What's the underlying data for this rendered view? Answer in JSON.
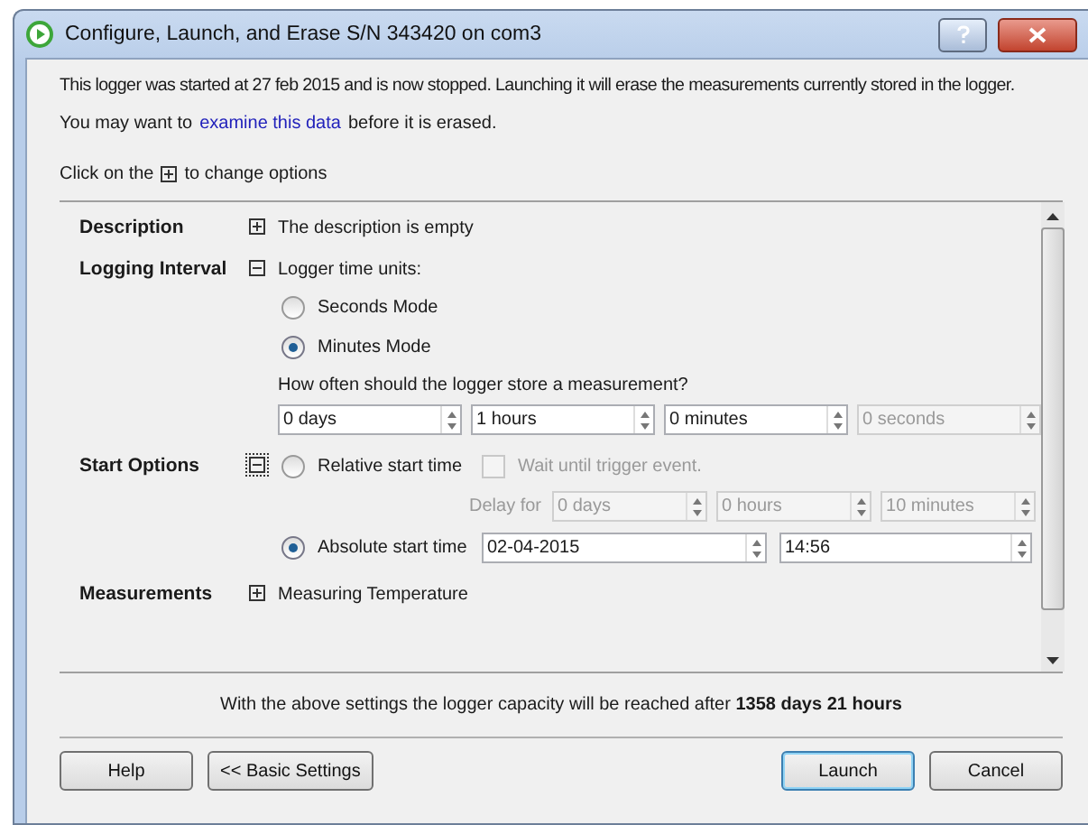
{
  "window": {
    "title": "Configure, Launch, and Erase S/N 343420 on com3"
  },
  "message": "This logger was started at 27 feb 2015 and is now stopped. Launching it will erase the measurements currently stored in the logger.",
  "hint": {
    "before": "You may want to",
    "link": "examine this data",
    "after": "before it is erased."
  },
  "instruction": {
    "before": "Click on the",
    "after": "to change options"
  },
  "sections": [
    {
      "kind": "summary",
      "label": "Description",
      "expanded": false,
      "focused": false,
      "summary": "The description is empty"
    },
    {
      "kind": "interval",
      "label": "Logging Interval",
      "expanded": true,
      "focused": false,
      "units_label": "Logger time units:",
      "modes": [
        {
          "label": "Seconds Mode",
          "selected": false
        },
        {
          "label": "Minutes Mode",
          "selected": true
        }
      ],
      "question": "How often should the logger store a measurement?",
      "fields": [
        {
          "value": "0 days",
          "disabled": false
        },
        {
          "value": "1 hours",
          "disabled": false
        },
        {
          "value": "0 minutes",
          "disabled": false
        },
        {
          "value": "0 seconds",
          "disabled": true
        }
      ]
    },
    {
      "kind": "start",
      "label": "Start Options",
      "expanded": true,
      "focused": true,
      "relative": {
        "label": "Relative start time",
        "selected": false
      },
      "trigger": {
        "label": "Wait until trigger event.",
        "checked": false,
        "disabled": true
      },
      "delay_label": "Delay for",
      "delay_fields": [
        {
          "value": "0 days",
          "disabled": true
        },
        {
          "value": "0 hours",
          "disabled": true
        },
        {
          "value": "10 minutes",
          "disabled": true
        }
      ],
      "absolute": {
        "label": "Absolute start time",
        "selected": true
      },
      "date": "02-04-2015",
      "time": "14:56"
    },
    {
      "kind": "summary",
      "label": "Measurements",
      "expanded": false,
      "focused": false,
      "summary": "Measuring Temperature"
    }
  ],
  "capacity": "With the above settings the logger capacity will be reached after **1358 days 21 hours**",
  "buttons_left": [
    {
      "label": "Help",
      "default": false
    },
    {
      "label": "<< Basic Settings",
      "default": false
    }
  ],
  "buttons_right": [
    {
      "label": "Launch",
      "default": true
    },
    {
      "label": "Cancel",
      "default": false
    }
  ]
}
